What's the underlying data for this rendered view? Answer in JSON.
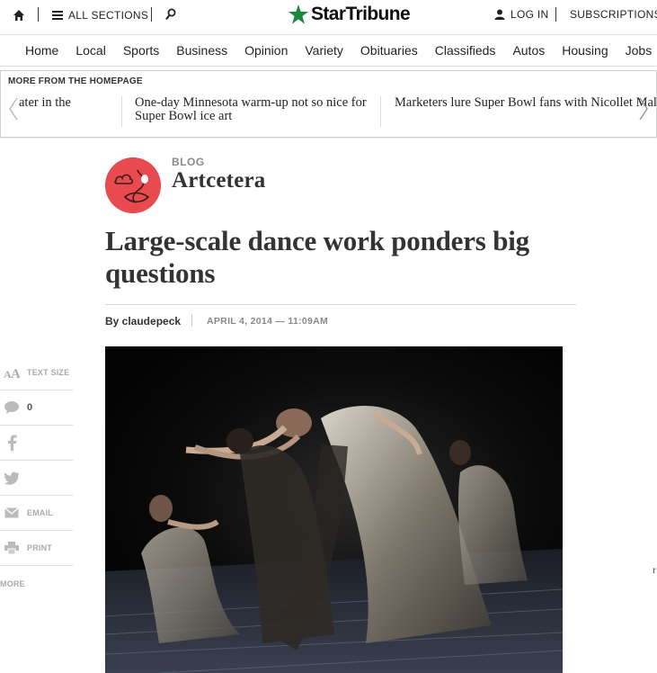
{
  "topbar": {
    "all_sections": "ALL SECTIONS",
    "brand": "StarTribune",
    "login": "LOG IN",
    "subscriptions": "SUBSCRIPTIONS"
  },
  "nav": {
    "items": [
      "Home",
      "Local",
      "Sports",
      "Business",
      "Opinion",
      "Variety",
      "Obituaries",
      "Classifieds",
      "Autos",
      "Housing",
      "Jobs"
    ]
  },
  "more_from_homepage": {
    "label": "MORE FROM THE HOMEPAGE",
    "stories": [
      "ater in the",
      "One-day Minnesota warm-up not so nice for Super Bowl ice art",
      "Marketers lure Super Bowl fans with Nicollet Mall truck tower, Mississippi zip"
    ]
  },
  "blog": {
    "kicker": "BLOG",
    "name": "Artcetera"
  },
  "article": {
    "headline": "Large-scale dance work ponders big questions",
    "byline": "By claudepeck",
    "date": "APRIL 4, 2014 — 11:09AM"
  },
  "tools": {
    "text_size": "TEXT SIZE",
    "comments_count": "0",
    "email": "EMAIL",
    "print": "PRINT",
    "more": "MORE"
  },
  "stray_char": "r",
  "colors": {
    "brand_green": "#1a8a3a",
    "blog_red": "#e84a4f"
  }
}
